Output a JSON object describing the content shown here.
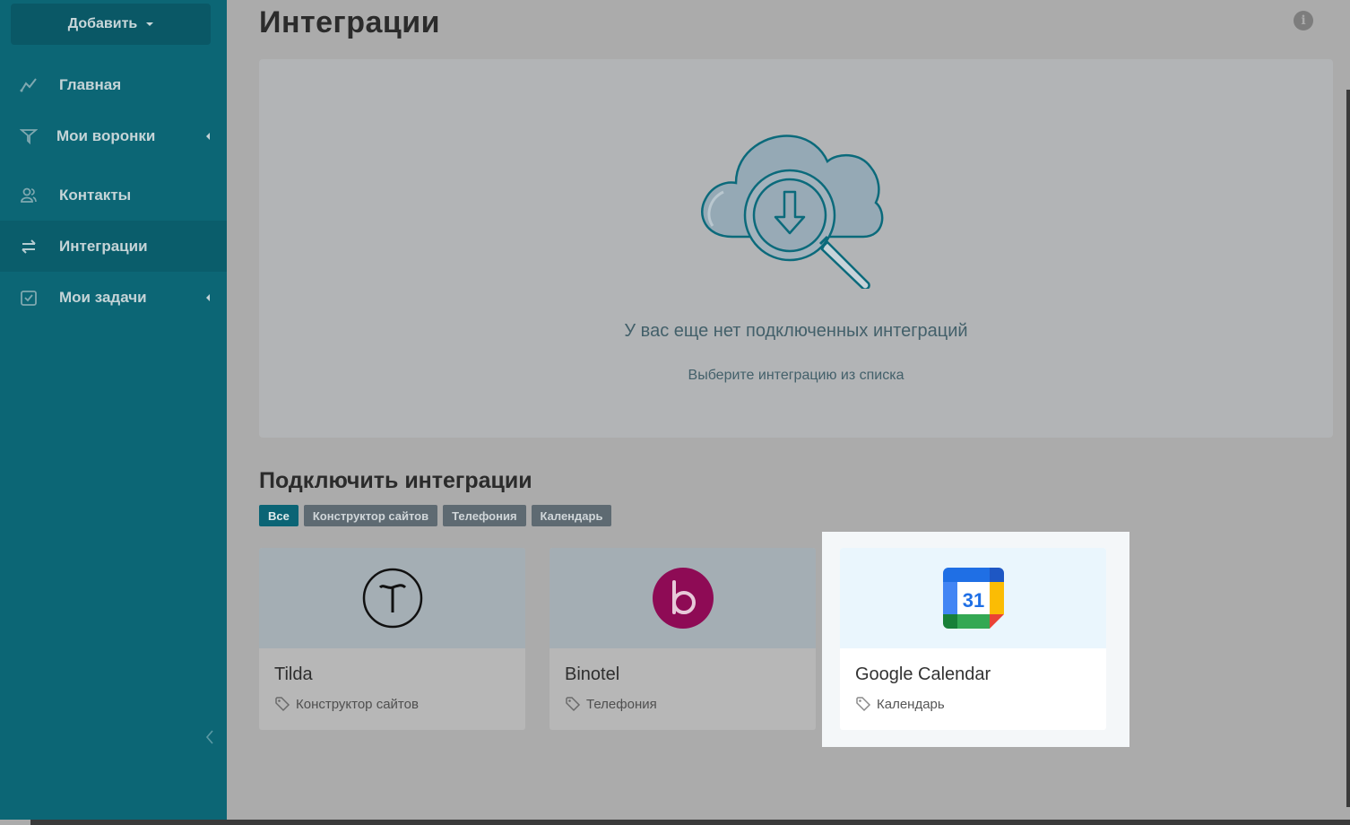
{
  "sidebar": {
    "add_label": "Добавить",
    "items": [
      {
        "label": "Главная",
        "icon": "chart-line-icon",
        "has_submenu": false,
        "active": false
      },
      {
        "label": "Мои воронки",
        "icon": "funnel-icon",
        "has_submenu": true,
        "active": false
      },
      {
        "label": "Контакты",
        "icon": "users-icon",
        "has_submenu": false,
        "active": false
      },
      {
        "label": "Интеграции",
        "icon": "exchange-arrows-icon",
        "has_submenu": false,
        "active": true
      },
      {
        "label": "Мои задачи",
        "icon": "checkbox-icon",
        "has_submenu": true,
        "active": false
      }
    ]
  },
  "header": {
    "title": "Интеграции"
  },
  "empty_state": {
    "title": "У вас еще нет подключенных интеграций",
    "subtitle": "Выберите интеграцию из списка"
  },
  "connect": {
    "title": "Подключить интеграции",
    "filters": [
      {
        "label": "Все",
        "active": true
      },
      {
        "label": "Конструктор сайтов",
        "active": false
      },
      {
        "label": "Телефония",
        "active": false
      },
      {
        "label": "Календарь",
        "active": false
      }
    ],
    "cards": [
      {
        "name": "Tilda",
        "category": "Конструктор сайтов",
        "logo": "tilda-logo-icon"
      },
      {
        "name": "Binotel",
        "category": "Телефония",
        "logo": "binotel-logo-icon"
      },
      {
        "name": "Google Calendar",
        "category": "Календарь",
        "logo": "google-calendar-logo-icon",
        "calendar_day": "31"
      }
    ]
  },
  "colors": {
    "sidebar": "#0c6675",
    "accent": "#0b6475",
    "binotel": "#8e0b55"
  }
}
